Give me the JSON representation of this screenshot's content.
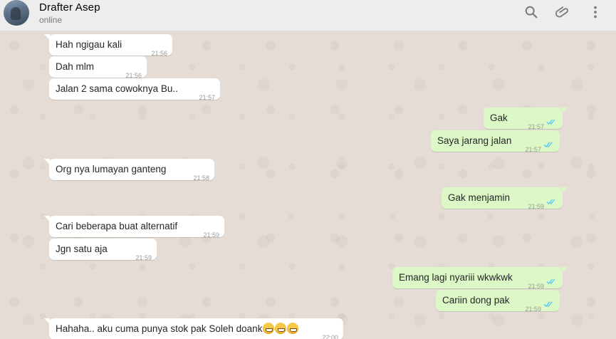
{
  "header": {
    "name": "Drafter Asep",
    "status": "online"
  },
  "messages": [
    {
      "dir": "in",
      "text": "Hah ngigau kali",
      "time": "21:56"
    },
    {
      "dir": "in",
      "text": "Dah mlm",
      "time": "21:56"
    },
    {
      "dir": "in",
      "text": "Jalan 2 sama cowoknya Bu..",
      "time": "21:57"
    },
    {
      "dir": "out",
      "text": "Gak",
      "time": "21:57",
      "status": "read"
    },
    {
      "dir": "out",
      "text": "Saya jarang jalan",
      "time": "21:57",
      "status": "read"
    },
    {
      "dir": "in",
      "text": "Org nya lumayan ganteng",
      "time": "21:58"
    },
    {
      "dir": "out",
      "text": "Gak menjamin",
      "time": "21:59",
      "status": "read"
    },
    {
      "dir": "in",
      "text": "Cari beberapa buat alternatif",
      "time": "21:59"
    },
    {
      "dir": "in",
      "text": "Jgn satu aja",
      "time": "21:59"
    },
    {
      "dir": "out",
      "text": "Emang lagi nyariii wkwkwk",
      "time": "21:59",
      "status": "read"
    },
    {
      "dir": "out",
      "text": "Cariin dong pak",
      "time": "21:59",
      "status": "read"
    },
    {
      "dir": "in",
      "text": "Hahaha.. aku cuma punya stok pak Soleh doank",
      "time": "22:00",
      "emojis": 3
    }
  ],
  "colors": {
    "incoming_bubble": "#ffffff",
    "outgoing_bubble": "#dcf8c6",
    "chat_background": "#e5ddd5",
    "read_ticks": "#4fc3f7",
    "header": "#ededed"
  },
  "icons": [
    "search-icon",
    "attach-icon",
    "menu-icon"
  ]
}
